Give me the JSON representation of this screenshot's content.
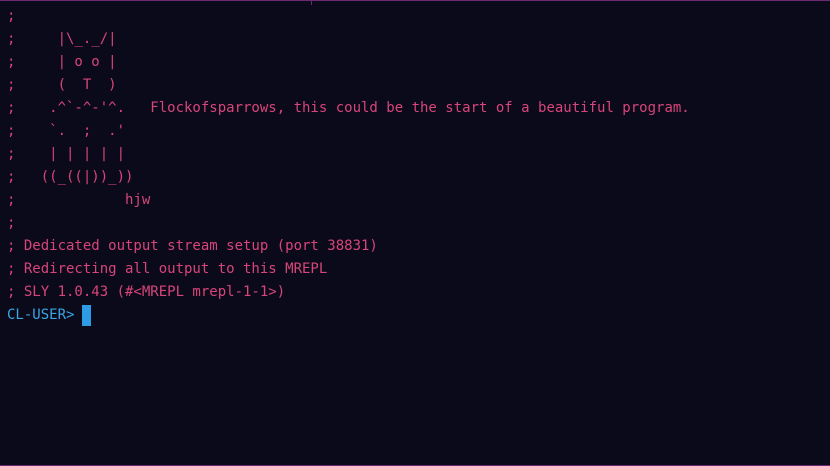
{
  "repl": {
    "banner_lines": [
      ";",
      ";     |\\_._/|",
      ";     | o o |",
      ";     (  T  )",
      ";    .^`-^-'^.   Flockofsparrows, this could be the start of a beautiful program.",
      ";    `.  ;  .'",
      ";    | | | | |",
      ";   ((_((|))_))",
      ";             hjw",
      ";",
      "; Dedicated output stream setup (port 38831)",
      "; Redirecting all output to this MREPL",
      "; SLY 1.0.43 (#<MREPL mrepl-1-1>)"
    ],
    "prompt": "CL-USER>"
  },
  "colors": {
    "background": "#0b0a1a",
    "comment_text": "#d8457a",
    "prompt_text": "#3aa6e6",
    "cursor": "#2e9be6",
    "border": "#6b2a72"
  }
}
